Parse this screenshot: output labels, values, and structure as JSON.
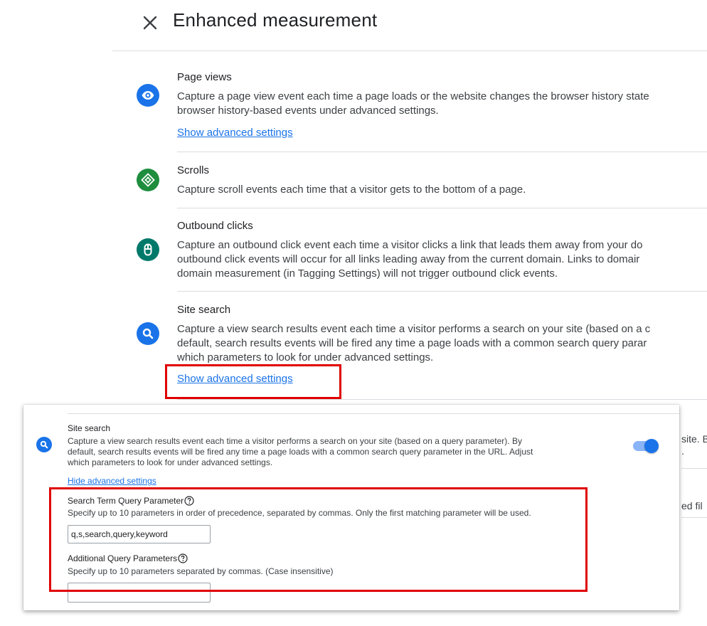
{
  "panel": {
    "title": "Enhanced measurement"
  },
  "items": [
    {
      "title": "Page views",
      "icon": "eye-icon",
      "icon_color": "#1a73e8",
      "desc_lines": [
        "Capture a page view event each time a page loads or the website changes the browser history state",
        "browser history-based events under advanced settings."
      ],
      "link": "Show advanced settings"
    },
    {
      "title": "Scrolls",
      "icon": "scroll-icon",
      "icon_color": "#1e8e3e",
      "desc_lines": [
        "Capture scroll events each time that a visitor gets to the bottom of a page."
      ]
    },
    {
      "title": "Outbound clicks",
      "icon": "mouse-icon",
      "icon_color": "#00796b",
      "desc_lines": [
        "Capture an outbound click event each time a visitor clicks a link that leads them away from your do",
        "outbound click events will occur for all links leading away from the current domain. Links to domair",
        "domain measurement (in Tagging Settings) will not trigger outbound click events."
      ]
    },
    {
      "title": "Site search",
      "icon": "search-icon",
      "icon_color": "#1a73e8",
      "desc_lines": [
        "Capture a view search results event each time a visitor performs a search on your site (based on a c",
        "default, search results events will be fired any time a page loads with a common search query parar",
        "which parameters to look for under advanced settings."
      ],
      "link": "Show advanced settings"
    }
  ],
  "overlay": {
    "title": "Site search",
    "desc_lines": [
      "Capture a view search results event each time a visitor performs a search on your site (based on a query parameter). By",
      "default, search results events will be fired any time a page loads with a common search query parameter in the URL. Adjust",
      "which parameters to look for under advanced settings."
    ],
    "hide_link": "Hide advanced settings",
    "toggle_on": true,
    "search_term": {
      "label": "Search Term Query Parameter",
      "help": "Specify up to 10 parameters in order of precedence, separated by commas. Only the first matching parameter will be used.",
      "value": "q,s,search,query,keyword"
    },
    "additional": {
      "label": "Additional Query Parameters",
      "help": "Specify up to 10 parameters separated by commas. (Case insensitive)",
      "value": ""
    }
  },
  "background_fragments": {
    "line1": "site. B",
    "line2": ".",
    "line3": "ed fil"
  },
  "colors": {
    "highlight": "#e00000",
    "link": "#1a73e8"
  }
}
